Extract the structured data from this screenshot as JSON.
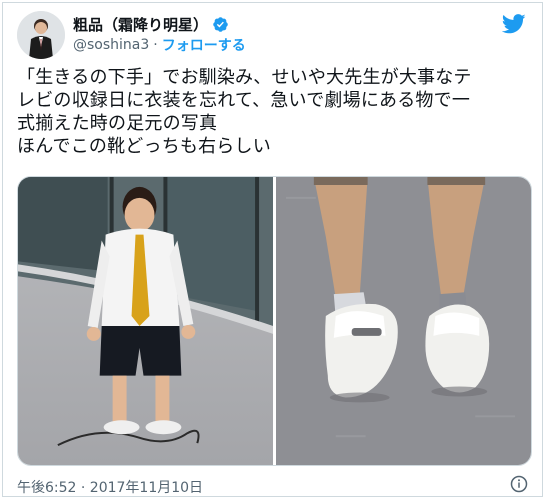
{
  "author": {
    "display_name": "粗品（霜降り明星）",
    "handle": "@soshina3",
    "separator": "·",
    "follow_label": "フォローする",
    "verified": true
  },
  "tweet": {
    "lines": [
      "「生きるの下手」でお馴染み、せいや大先生が大事なテ",
      "レビの収録日に衣装を忘れて、急いで劇場にある物で一",
      "式揃えた時の足元の写真",
      "ほんでこの靴どっちも右らしい"
    ],
    "timestamp": "午後6:52 · 2017年11月10日"
  },
  "media": [
    {
      "icon": "photo-man-standing"
    },
    {
      "icon": "photo-feet-white-loafers"
    }
  ],
  "colors": {
    "accent": "#1d9bf0",
    "text": "#0f1419",
    "muted": "#536471",
    "border": "#cfd9de"
  },
  "icons": {
    "brand": "twitter-bird-icon",
    "verified": "verified-badge-icon",
    "info": "info-icon"
  }
}
